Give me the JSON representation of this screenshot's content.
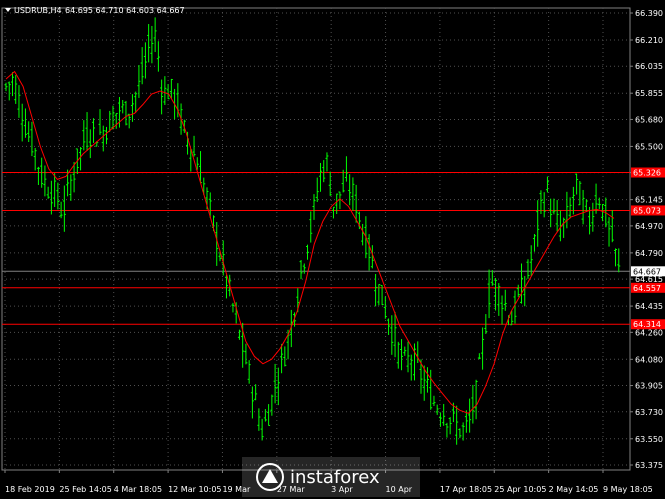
{
  "header": {
    "symbol": "USDRUB,H4",
    "ohlc": "64.695 64.710 64.603 64.667"
  },
  "colors": {
    "background": "#000000",
    "candle": "#00ff00",
    "ma": "#ff0000",
    "hline": "#ff0000",
    "grid": "#505050",
    "text": "#ffffff",
    "current_price_tag": "#ffffff"
  },
  "chart_data": {
    "type": "candlestick",
    "ylim": [
      63.375,
      66.39
    ],
    "y_ticks": [
      "66.390",
      "66.210",
      "66.035",
      "65.855",
      "65.680",
      "65.500",
      "65.325",
      "65.145",
      "64.970",
      "64.790",
      "64.615",
      "64.435",
      "64.260",
      "64.080",
      "63.905",
      "63.730",
      "63.550",
      "63.375"
    ],
    "x_ticks": [
      "18 Feb 2019",
      "25 Feb 14:05",
      "4 Mar 18:05",
      "12 Mar 10:05",
      "19 Mar",
      "27 Mar",
      "3 Apr",
      "10 Apr",
      "17 Apr 18:05",
      "25 Apr 10:05",
      "2 May 14:05",
      "9 May 18:05"
    ],
    "horizontal_levels": [
      {
        "label": "65.326",
        "value": 65.326
      },
      {
        "label": "65.073",
        "value": 65.073
      },
      {
        "label": "64.557",
        "value": 64.557
      },
      {
        "label": "64.314",
        "value": 64.314
      }
    ],
    "current_price": {
      "label": "64.667",
      "value": 64.667
    },
    "close": [
      65.9,
      65.95,
      65.78,
      65.6,
      65.48,
      65.3,
      65.22,
      65.18,
      65.05,
      65.25,
      65.4,
      65.55,
      65.6,
      65.58,
      65.62,
      65.7,
      65.75,
      65.72,
      65.82,
      65.95,
      66.15,
      66.25,
      65.85,
      65.88,
      65.8,
      65.6,
      65.5,
      65.38,
      65.2,
      65.0,
      64.8,
      64.6,
      64.4,
      64.2,
      64.0,
      63.8,
      63.6,
      63.75,
      63.95,
      64.1,
      64.3,
      64.55,
      64.8,
      65.0,
      65.3,
      65.4,
      65.1,
      65.2,
      65.25,
      65.15,
      64.95,
      64.8,
      64.6,
      64.45,
      64.3,
      64.15,
      64.05,
      64.1,
      64.0,
      63.9,
      63.8,
      63.75,
      63.7,
      63.65,
      63.6,
      63.65,
      63.85,
      64.2,
      64.6,
      64.55,
      64.45,
      64.35,
      64.5,
      64.6,
      64.8,
      65.1,
      65.2,
      65.0,
      64.95,
      65.05,
      65.25,
      65.1,
      65.0,
      65.2,
      65.05,
      64.9,
      64.67
    ],
    "ma": [
      65.95,
      66.0,
      65.9,
      65.7,
      65.5,
      65.35,
      65.28,
      65.3,
      65.38,
      65.45,
      65.5,
      65.55,
      65.6,
      65.65,
      65.7,
      65.72,
      65.78,
      65.85,
      65.87,
      65.85,
      65.75,
      65.6,
      65.4,
      65.2,
      65.0,
      64.8,
      64.6,
      64.4,
      64.2,
      64.1,
      64.05,
      64.08,
      64.15,
      64.25,
      64.4,
      64.6,
      64.85,
      65.0,
      65.1,
      65.15,
      65.1,
      65.0,
      64.9,
      64.75,
      64.6,
      64.45,
      64.3,
      64.2,
      64.1,
      64.0,
      63.92,
      63.85,
      63.78,
      63.74,
      63.72,
      63.78,
      63.9,
      64.05,
      64.25,
      64.4,
      64.5,
      64.6,
      64.7,
      64.8,
      64.9,
      64.98,
      65.03,
      65.05,
      65.07,
      65.08,
      65.06,
      65.02
    ]
  },
  "watermark": {
    "brand": "instaforex"
  }
}
